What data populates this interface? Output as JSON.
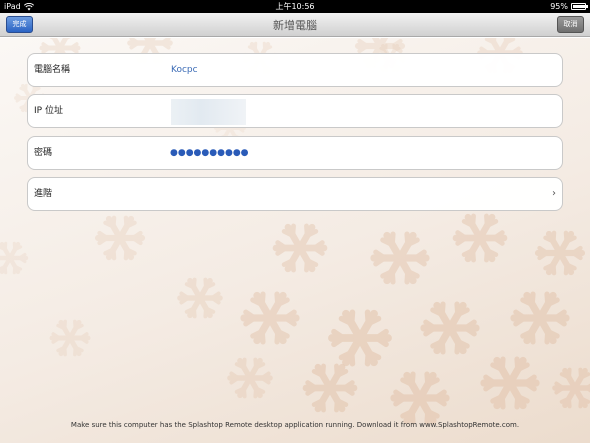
{
  "status_bar": {
    "device": "iPad",
    "time": "上午10:56",
    "battery_text": "95%",
    "battery_level": 0.95
  },
  "nav": {
    "title": "新增電腦",
    "done_label": "完成",
    "cancel_label": "取消"
  },
  "form": {
    "computer_name_label": "電腦名稱",
    "computer_name_value": "Kocpc",
    "ip_label": "IP 位址",
    "password_label": "密碼",
    "password_value": "●●●●●●●●●●",
    "advanced_label": "進階",
    "chevron": "›"
  },
  "footer": {
    "text": "Make sure this computer has the Splashtop Remote desktop application running. Download it from www.SplashtopRemote.com."
  },
  "colors": {
    "accent_blue": "#3a6ab5",
    "snowflake": "#e6cbb6"
  }
}
